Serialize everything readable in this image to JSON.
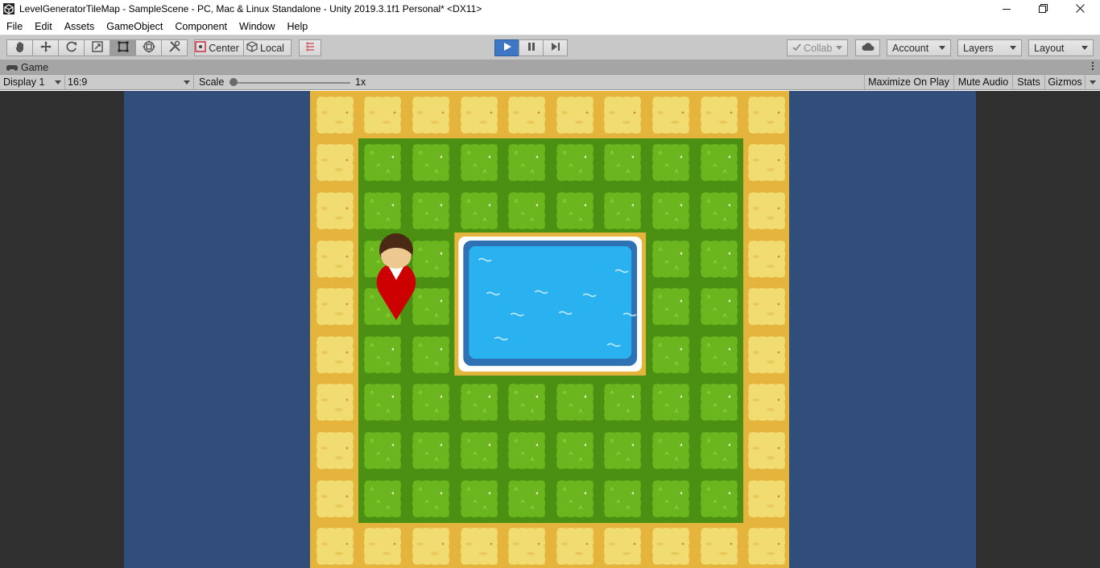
{
  "window": {
    "title": "LevelGeneratorTileMap - SampleScene - PC, Mac & Linux Standalone - Unity 2019.3.1f1 Personal* <DX11>",
    "controls": [
      "minimize-icon",
      "restore-icon",
      "close-icon"
    ]
  },
  "menu": {
    "items": [
      {
        "label": "File"
      },
      {
        "label": "Edit"
      },
      {
        "label": "Assets"
      },
      {
        "label": "GameObject"
      },
      {
        "label": "Component"
      },
      {
        "label": "Window"
      },
      {
        "label": "Help"
      }
    ]
  },
  "toolbar": {
    "tools": [
      "hand-icon",
      "move-icon",
      "rotate-icon",
      "scale-icon",
      "rect-tool-icon",
      "transform-icon",
      "custom-tool-icon"
    ],
    "active_tool": "rect-tool-icon",
    "pivot_label": "Center",
    "space_label": "Local",
    "play_controls": [
      "play-icon",
      "pause-icon",
      "step-icon"
    ],
    "playing": true,
    "collab_label": "Collab",
    "account_label": "Account",
    "layers_label": "Layers",
    "layout_label": "Layout"
  },
  "game_view": {
    "tab_label": "Game",
    "display_label": "Display 1",
    "aspect_label": "16:9",
    "scale_label": "Scale",
    "scale_value": "1x",
    "scale_slider_fraction": 0.0,
    "maximize_on_play_label": "Maximize On Play",
    "mute_audio_label": "Mute Audio",
    "stats_label": "Stats",
    "gizmos_label": "Gizmos",
    "maximize_on_play": false,
    "mute_audio": false,
    "stats": false,
    "gizmos": false
  },
  "scene": {
    "colors": {
      "editor_bg": "#303030",
      "camera_bg": "#314d79",
      "sand": "#f1dc72",
      "sand_border": "#e4b43c",
      "grass": "#6bb51f",
      "grass_border": "#4b8f13",
      "water": "#29b2ef",
      "water_deep": "#2f72b4",
      "player_body": "#cc0000",
      "player_hair": "#4a2a14",
      "player_skin": "#edc890"
    },
    "grid": {
      "cols": 10,
      "rows": 10
    },
    "player": {
      "col": 1,
      "row": 3
    }
  }
}
